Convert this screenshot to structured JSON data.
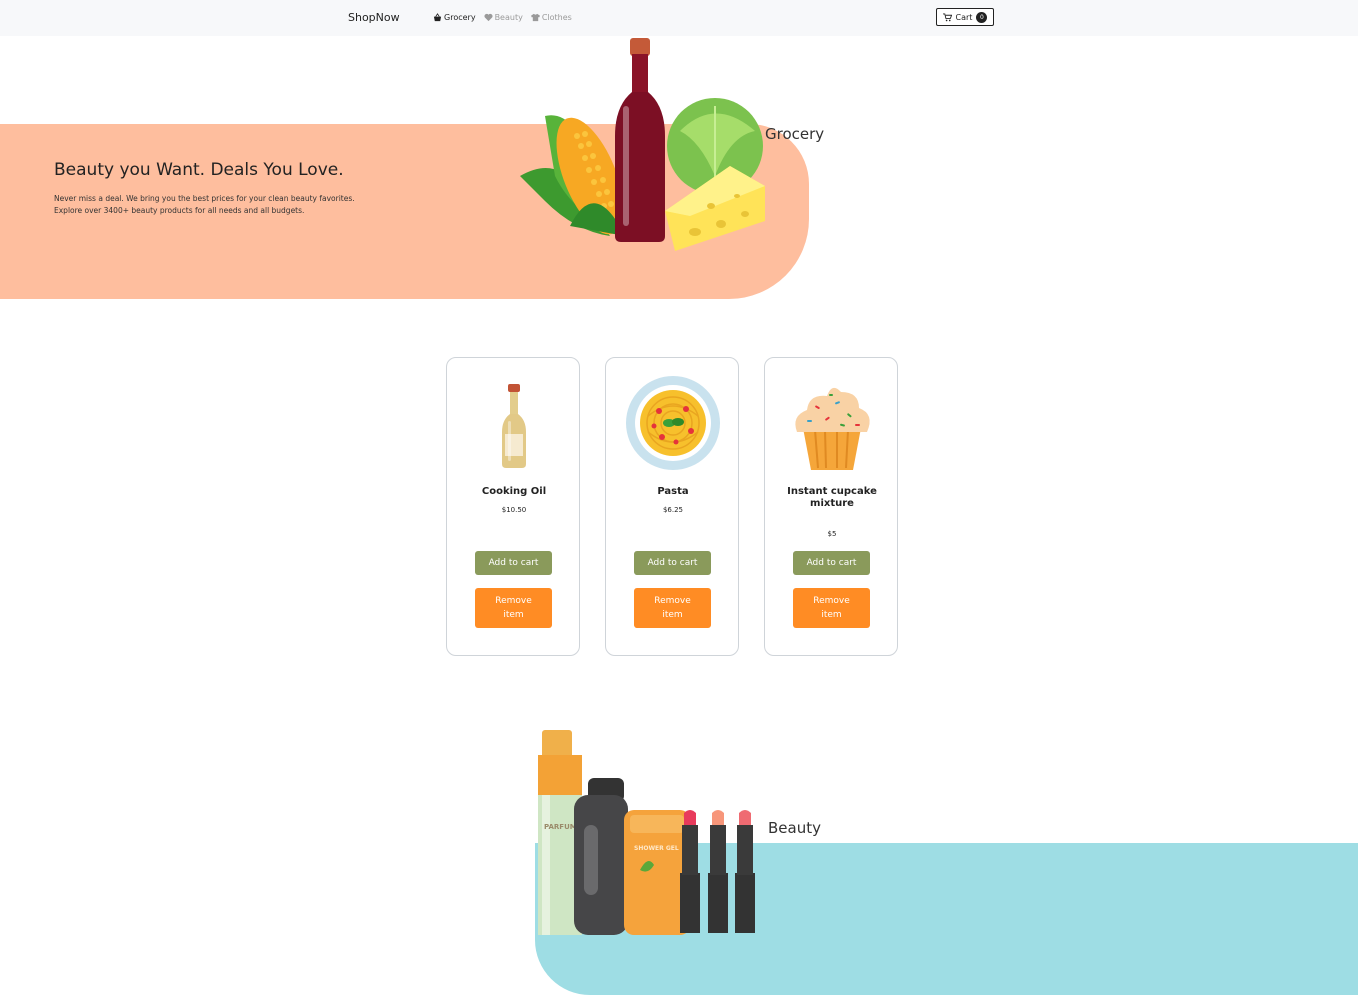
{
  "navbar": {
    "brand": "ShopNow",
    "links": [
      {
        "label": "Grocery",
        "icon": "basket-icon",
        "active": true
      },
      {
        "label": "Beauty",
        "icon": "heart-icon",
        "active": false
      },
      {
        "label": "Clothes",
        "icon": "tshirt-icon",
        "active": false
      }
    ],
    "cart": {
      "label": "Cart",
      "count": "0",
      "icon": "cart-icon"
    }
  },
  "hero": {
    "title": "Beauty you Want. Deals You Love.",
    "text": "Never miss a deal. We bring you the best prices for your clean beauty favorites. Explore over 3400+ beauty products for all needs and all budgets.",
    "section_label": "Grocery",
    "band_color": "#febe9e"
  },
  "products": [
    {
      "name": "Cooking Oil",
      "price": "$10.50",
      "add_label": "Add to cart",
      "remove_label": "Remove item",
      "image": "cooking-oil-bottle"
    },
    {
      "name": "Pasta",
      "price": "$6.25",
      "add_label": "Add to cart",
      "remove_label": "Remove item",
      "image": "pasta-plate"
    },
    {
      "name": "Instant cupcake mixture",
      "price": "$5",
      "add_label": "Add to cart",
      "remove_label": "Remove item",
      "image": "cupcake"
    }
  ],
  "beauty": {
    "section_label": "Beauty",
    "band_color": "#9edde4",
    "art_labels": {
      "parfum": "PARFUM",
      "shower_gel": "SHOWER GEL"
    }
  },
  "colors": {
    "add_button": "#8a9a5b",
    "remove_button": "#ff8c24"
  }
}
